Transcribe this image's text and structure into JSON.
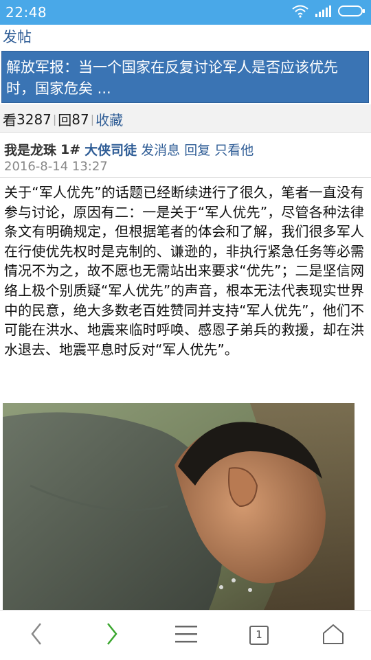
{
  "status_bar": {
    "time": "22:48",
    "icons": [
      "wifi-icon",
      "signal-icon",
      "battery-icon"
    ]
  },
  "header": {
    "post_link": "发帖"
  },
  "thread": {
    "title": "解放军报：当一个国家在反复讨论军人是否应该优先时，国家危矣 ...",
    "views_label": "看",
    "views": "3287",
    "replies_label": "回",
    "replies": "87",
    "favorite": "收藏"
  },
  "post": {
    "author": "我是龙珠",
    "floor": "1#",
    "user_group": "大侠司徒",
    "action_message": "发消息",
    "action_reply": "回复",
    "action_only": "只看他",
    "date": "2016-8-14 13:27",
    "content": "关于“军人优先”的话题已经断续进行了很久，笔者一直没有参与讨论，原因有二：一是关于“军人优先”，尽管各种法律条文有明确规定，但根据笔者的体会和了解，我们很多军人在行使优先权时是克制的、谦逊的，非执行紧急任务等必需情况不为之，故不愿也无需站出来要求“优先”；二是坚信网络上极个别质疑“军人优先”的声音，根本无法代表现实世界中的民意，绝大多数老百姓赞同并支持“军人优先”，他们不可能在洪水、地震来临时呼唤、感恩子弟兵的救援，却在洪水退去、地震平息时反对“军人优先”。"
  },
  "bottom_nav": {
    "tab_count": "1",
    "icons": [
      "back-icon",
      "forward-icon",
      "menu-icon",
      "tabs-icon",
      "home-icon"
    ],
    "colors": {
      "back": "#888888",
      "forward": "#3aa62e",
      "other": "#666666"
    }
  },
  "theme": {
    "status_bar": "#49a8e8",
    "title_bar": "#3a74b4",
    "link": "#2f5d96"
  }
}
